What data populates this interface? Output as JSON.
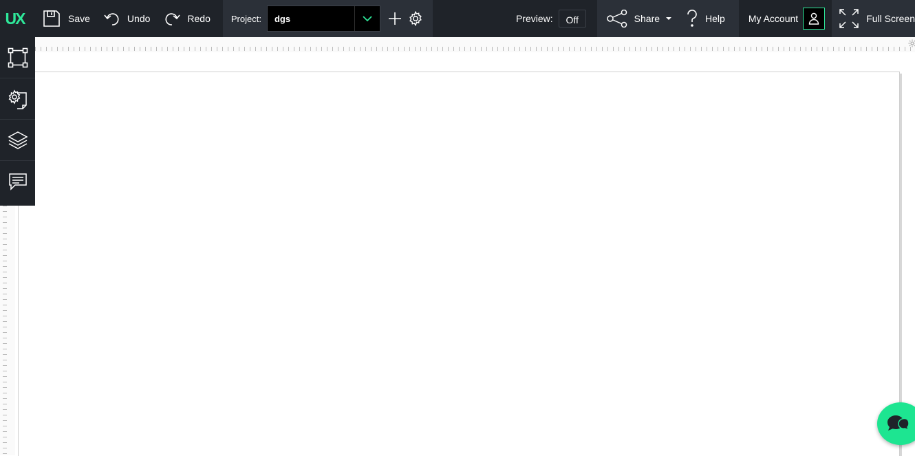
{
  "logo": "UX",
  "toolbar": {
    "save_label": "Save",
    "undo_label": "Undo",
    "redo_label": "Redo"
  },
  "project": {
    "label": "Project:",
    "value": "dgs"
  },
  "preview": {
    "label": "Preview:",
    "state": "Off"
  },
  "share_label": "Share",
  "help_label": "Help",
  "account_label": "My Account",
  "fullscreen_label": "Full Screen",
  "colors": {
    "accent": "#2ee89a",
    "toolbar_bg": "#1f2329",
    "chat_button": "#1de591"
  },
  "icons": {
    "save": "floppy-disk-icon",
    "undo": "undo-arrow-icon",
    "redo": "redo-arrow-icon",
    "add": "plus-icon",
    "settings": "gear-icon",
    "share": "share-nodes-icon",
    "help": "question-mark-icon",
    "account": "user-icon",
    "fullscreen": "expand-icon",
    "sidebar": [
      "artboard-icon",
      "page-settings-icon",
      "layers-icon",
      "comments-icon"
    ],
    "chat": "chat-bubbles-icon"
  }
}
